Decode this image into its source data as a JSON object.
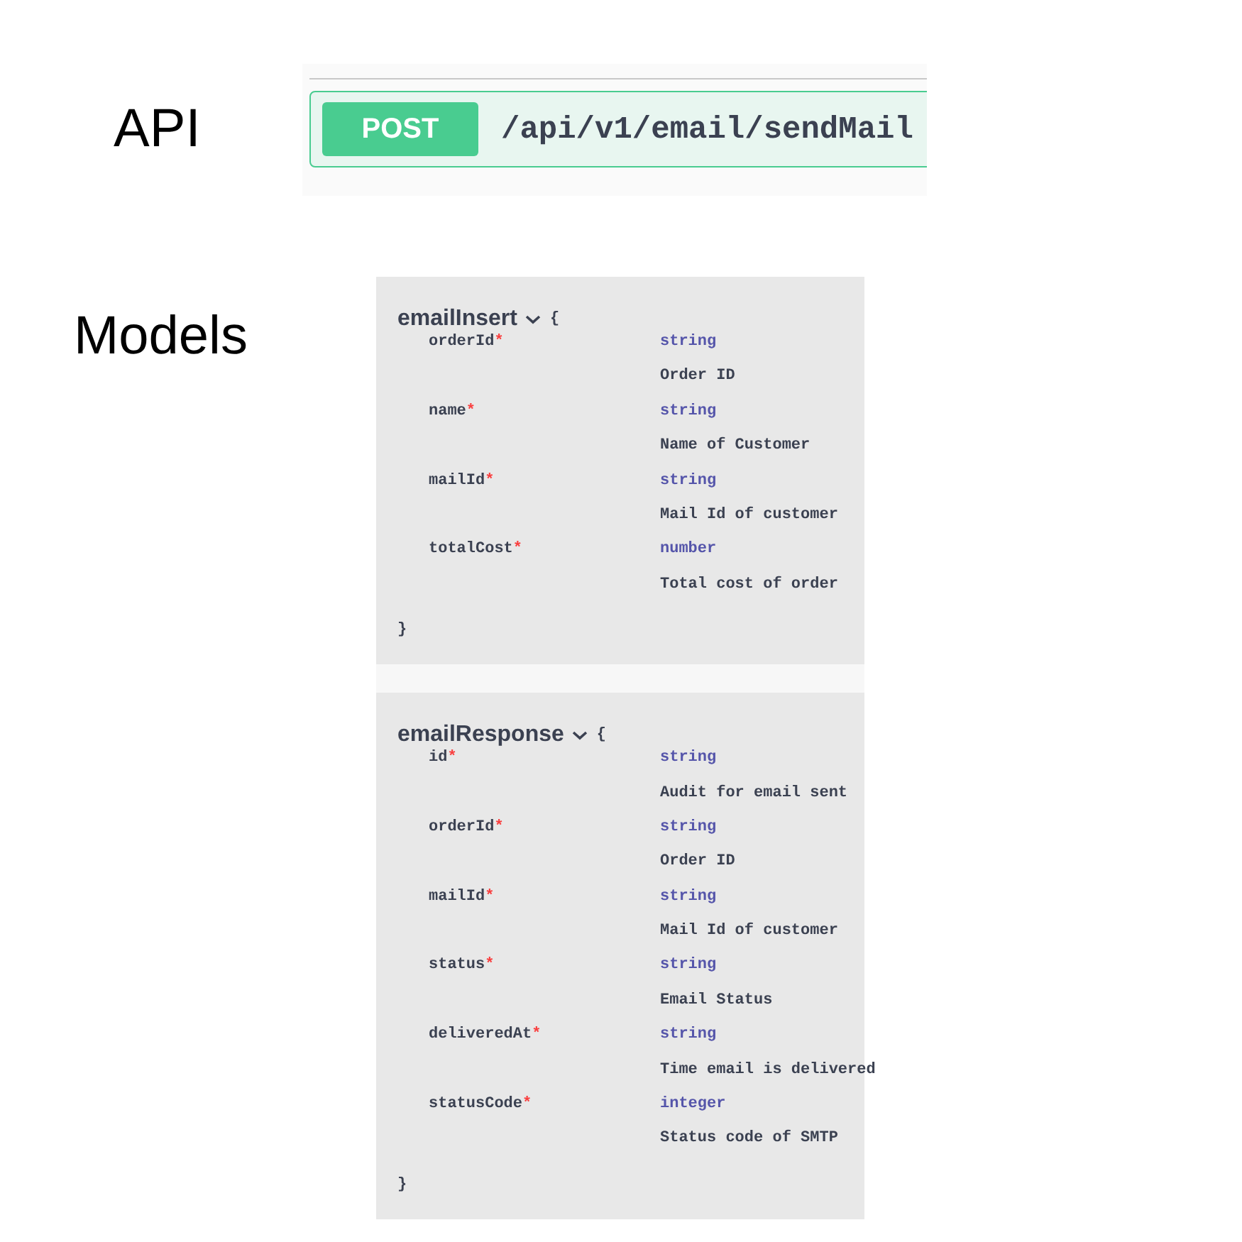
{
  "api": {
    "label": "API",
    "method": "POST",
    "path": "/api/v1/email/sendMail"
  },
  "models": {
    "label": "Models",
    "items": [
      {
        "name": "emailInsert",
        "expanded": true,
        "open_brace": "{",
        "close_brace": "}",
        "properties": [
          {
            "name": "orderId",
            "required": true,
            "required_mark": "*",
            "type": "string",
            "description": "Order ID"
          },
          {
            "name": "name",
            "required": true,
            "required_mark": "*",
            "type": "string",
            "description": "Name of Customer"
          },
          {
            "name": "mailId",
            "required": true,
            "required_mark": "*",
            "type": "string",
            "description": "Mail Id of customer"
          },
          {
            "name": "totalCost",
            "required": true,
            "required_mark": "*",
            "type": "number",
            "description": "Total cost of order"
          }
        ]
      },
      {
        "name": "emailResponse",
        "expanded": true,
        "open_brace": "{",
        "close_brace": "}",
        "properties": [
          {
            "name": "id",
            "required": true,
            "required_mark": "*",
            "type": "string",
            "description": "Audit for email sent"
          },
          {
            "name": "orderId",
            "required": true,
            "required_mark": "*",
            "type": "string",
            "description": "Order ID"
          },
          {
            "name": "mailId",
            "required": true,
            "required_mark": "*",
            "type": "string",
            "description": "Mail Id of customer"
          },
          {
            "name": "status",
            "required": true,
            "required_mark": "*",
            "type": "string",
            "description": "Email Status"
          },
          {
            "name": "deliveredAt",
            "required": true,
            "required_mark": "*",
            "type": "string",
            "description": "Time email is delivered"
          },
          {
            "name": "statusCode",
            "required": true,
            "required_mark": "*",
            "type": "integer",
            "description": "Status code of SMTP"
          }
        ]
      }
    ]
  }
}
